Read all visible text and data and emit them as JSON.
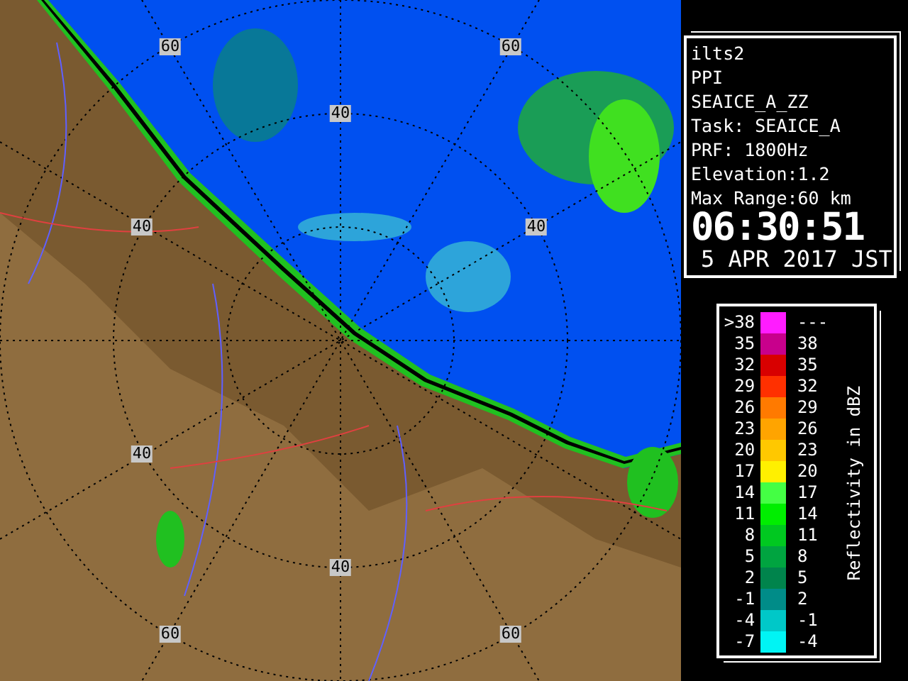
{
  "map": {
    "range_labels": [
      "60",
      "60",
      "40",
      "40",
      "40",
      "40",
      "40",
      "60",
      "60"
    ]
  },
  "info": {
    "lines": [
      "ilts2",
      "PPI",
      "SEAICE_A_ZZ",
      "Task: SEAICE_A",
      "PRF: 1800Hz",
      "Elevation:1.2",
      "Max Range:60 km"
    ],
    "time": "06:30:51",
    "date": "5 APR 2017 JST"
  },
  "legend": {
    "title": "Reflectivity in dBZ",
    "rows": [
      {
        "low": ">38",
        "high": "---",
        "color": "#ff1cff"
      },
      {
        "low": "35",
        "high": "38",
        "color": "#c8008c"
      },
      {
        "low": "32",
        "high": "35",
        "color": "#d80000"
      },
      {
        "low": "29",
        "high": "32",
        "color": "#ff3000"
      },
      {
        "low": "26",
        "high": "29",
        "color": "#ff7a00"
      },
      {
        "low": "23",
        "high": "26",
        "color": "#ffa400"
      },
      {
        "low": "20",
        "high": "23",
        "color": "#ffc800"
      },
      {
        "low": "17",
        "high": "20",
        "color": "#fff000"
      },
      {
        "low": "14",
        "high": "17",
        "color": "#44ff44"
      },
      {
        "low": "11",
        "high": "14",
        "color": "#00ee00"
      },
      {
        "low": "8",
        "high": "11",
        "color": "#00c820"
      },
      {
        "low": "5",
        "high": "8",
        "color": "#00a440"
      },
      {
        "low": "2",
        "high": "5",
        "color": "#00844c"
      },
      {
        "low": "-1",
        "high": "2",
        "color": "#008c88"
      },
      {
        "low": "-4",
        "high": "-1",
        "color": "#00c8c8"
      },
      {
        "low": "-7",
        "high": "-4",
        "color": "#00f4f4"
      }
    ]
  }
}
